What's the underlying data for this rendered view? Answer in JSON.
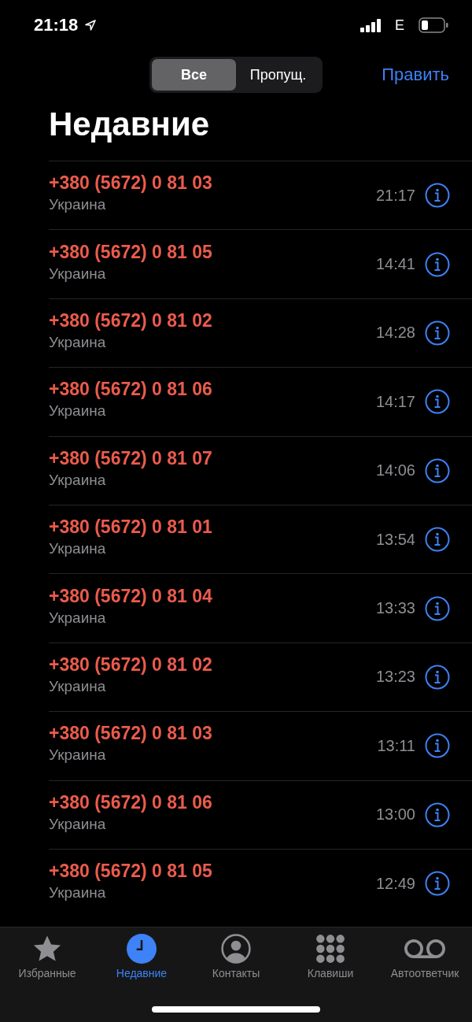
{
  "status_bar": {
    "time": "21:18",
    "network": "E"
  },
  "segments": [
    {
      "label": "Все",
      "selected": true
    },
    {
      "label": "Пропущ.",
      "selected": false
    }
  ],
  "edit_button": "Править",
  "title": "Недавние",
  "calls": [
    {
      "number": "+380 (5672) 0 81 03",
      "label": "Украина",
      "time": "21:17",
      "missed": true
    },
    {
      "number": "+380 (5672) 0 81 05",
      "label": "Украина",
      "time": "14:41",
      "missed": true
    },
    {
      "number": "+380 (5672) 0 81 02",
      "label": "Украина",
      "time": "14:28",
      "missed": true
    },
    {
      "number": "+380 (5672) 0 81 06",
      "label": "Украина",
      "time": "14:17",
      "missed": true
    },
    {
      "number": "+380 (5672) 0 81 07",
      "label": "Украина",
      "time": "14:06",
      "missed": true
    },
    {
      "number": "+380 (5672) 0 81 01",
      "label": "Украина",
      "time": "13:54",
      "missed": true
    },
    {
      "number": "+380 (5672) 0 81 04",
      "label": "Украина",
      "time": "13:33",
      "missed": true
    },
    {
      "number": "+380 (5672) 0 81 02",
      "label": "Украина",
      "time": "13:23",
      "missed": true
    },
    {
      "number": "+380 (5672) 0 81 03",
      "label": "Украина",
      "time": "13:11",
      "missed": true
    },
    {
      "number": "+380 (5672) 0 81 06",
      "label": "Украина",
      "time": "13:00",
      "missed": true
    },
    {
      "number": "+380 (5672) 0 81 05",
      "label": "Украина",
      "time": "12:49",
      "missed": true
    }
  ],
  "tab_bar": [
    {
      "kind": "favorites",
      "label": "Избранные",
      "selected": false
    },
    {
      "kind": "recents",
      "label": "Недавние",
      "selected": true
    },
    {
      "kind": "contacts",
      "label": "Контакты",
      "selected": false
    },
    {
      "kind": "keypad",
      "label": "Клавиши",
      "selected": false
    },
    {
      "kind": "voicemail",
      "label": "Автоответчик",
      "selected": false
    }
  ]
}
